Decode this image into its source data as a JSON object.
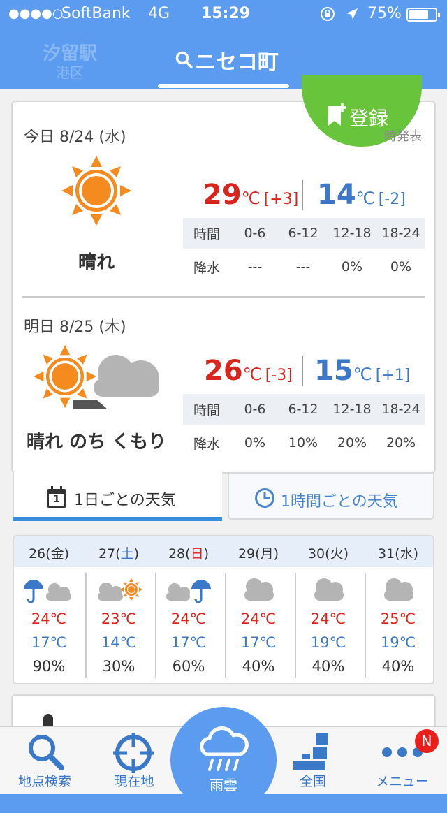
{
  "status": {
    "signal": "●●●●○",
    "carrier": "SoftBank",
    "network": "4G",
    "time": "15:29",
    "battery_text": "75%",
    "battery_level": 0.75
  },
  "header": {
    "location_name": "汐留駅",
    "location_ward": "港区",
    "title": "ニセコ町"
  },
  "register_button": {
    "label": "登録"
  },
  "today": {
    "date": "今日 8/24 (水)",
    "published": "時発表",
    "weather": "晴れ",
    "high": "29",
    "high_diff": "[+3]",
    "low": "14",
    "low_diff": "[-2]",
    "unit": "℃",
    "precip_header": [
      "時間",
      "0-6",
      "6-12",
      "12-18",
      "18-24"
    ],
    "precip_values": [
      "降水",
      "---",
      "---",
      "0%",
      "0%"
    ]
  },
  "tomorrow": {
    "date": "明日 8/25 (木)",
    "weather": "晴れ のち くもり",
    "high": "26",
    "high_diff": "[-3]",
    "low": "15",
    "low_diff": "[+1]",
    "unit": "℃",
    "precip_header": [
      "時間",
      "0-6",
      "6-12",
      "12-18",
      "18-24"
    ],
    "precip_values": [
      "降水",
      "0%",
      "10%",
      "20%",
      "20%"
    ]
  },
  "tabs": {
    "daily": "1日ごとの天気",
    "daily_icon_num": "1",
    "hourly": "1時間ごとの天気"
  },
  "weekly": [
    {
      "day": "26",
      "dow": "金",
      "icon": "rain-umbrella-then-cloud-icon",
      "high": "24℃",
      "low": "17℃",
      "precip": "90%"
    },
    {
      "day": "27",
      "dow": "土",
      "icon": "cloud-then-sun-icon",
      "high": "23℃",
      "low": "14℃",
      "precip": "30%"
    },
    {
      "day": "28",
      "dow": "日",
      "icon": "cloud-then-rain-icon",
      "high": "24℃",
      "low": "17℃",
      "precip": "60%"
    },
    {
      "day": "29",
      "dow": "月",
      "icon": "cloud-icon",
      "high": "24℃",
      "low": "17℃",
      "precip": "40%"
    },
    {
      "day": "30",
      "dow": "火",
      "icon": "cloud-icon",
      "high": "24℃",
      "low": "19℃",
      "precip": "40%"
    },
    {
      "day": "31",
      "dow": "水",
      "icon": "cloud-icon",
      "high": "25℃",
      "low": "19℃",
      "precip": "40%"
    }
  ],
  "nav": {
    "search": "地点検索",
    "current": "現在地",
    "rain": "雨雲",
    "nation": "全国",
    "menu": "メニュー",
    "badge": "N"
  },
  "colors": {
    "accent": "#5b9cf0",
    "high": "#d8251e",
    "low": "#3d78c8",
    "register": "#68c43a"
  }
}
